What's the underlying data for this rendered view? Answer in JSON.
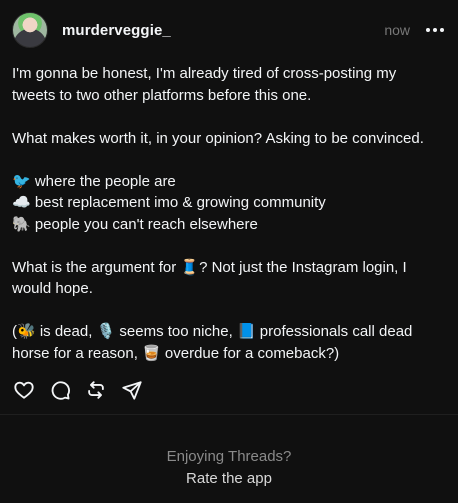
{
  "post": {
    "username": "murderveggie_",
    "time": "now",
    "avatar_icon": "avatar-image",
    "more_icon": "more-horizontal-icon",
    "paragraphs": [
      [
        "I'm gonna be honest, I'm already tired of cross-posting my",
        "tweets to two other platforms before this one."
      ],
      [
        "What makes worth it, in your opinion? Asking to be convinced."
      ],
      [
        "🐦 where the people are",
        "☁️ best replacement imo & growing community",
        "🐘 people you can't reach elsewhere"
      ],
      [
        "What is the argument for 🧵? Not just the Instagram login, I",
        "would hope."
      ],
      [
        "(🐝 is dead, 🎙️ seems too niche, 📘 professionals call dead",
        "horse for a reason, 🥃 overdue for a comeback?)"
      ]
    ]
  },
  "actions": {
    "like": "heart-icon",
    "reply": "comment-icon",
    "repost": "repost-icon",
    "share": "send-icon"
  },
  "footer": {
    "question": "Enjoying Threads?",
    "rate": "Rate the app"
  },
  "colors": {
    "background": "#101010",
    "text": "#f3f5f7",
    "muted": "#777777"
  }
}
